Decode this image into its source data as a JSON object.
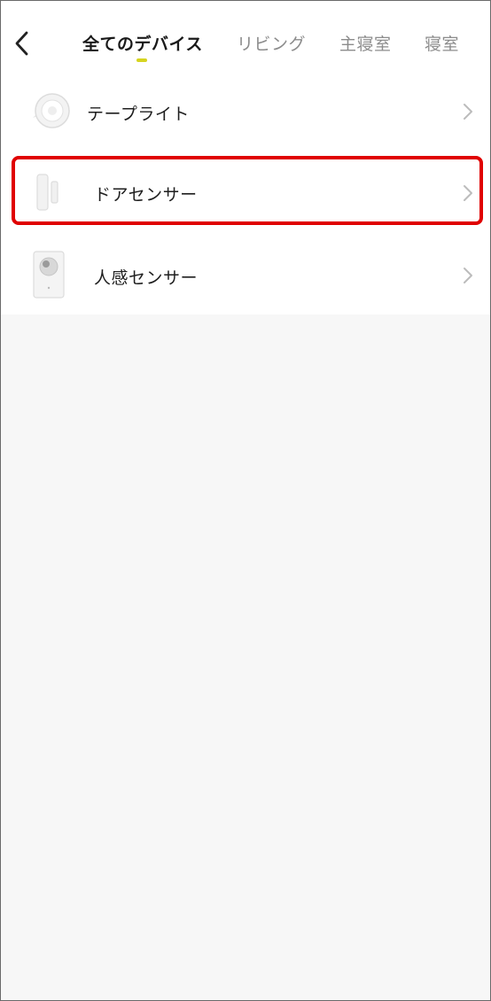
{
  "header": {
    "back_icon": "chevron-left-icon",
    "tabs": [
      {
        "label": "全てのデバイス",
        "active": true
      },
      {
        "label": "リビング",
        "active": false
      },
      {
        "label": "主寝室",
        "active": false
      },
      {
        "label": "寝室",
        "active": false
      }
    ],
    "active_indicator_color": "#d6d41f"
  },
  "devices": [
    {
      "name": "テープライト",
      "icon": "tape-light-icon"
    },
    {
      "name": "ドアセンサー",
      "icon": "door-sensor-icon"
    },
    {
      "name": "人感センサー",
      "icon": "motion-sensor-icon"
    }
  ],
  "colors": {
    "highlight": "#e00000",
    "list_background": "#ffffff",
    "page_background": "#f7f7f7"
  }
}
